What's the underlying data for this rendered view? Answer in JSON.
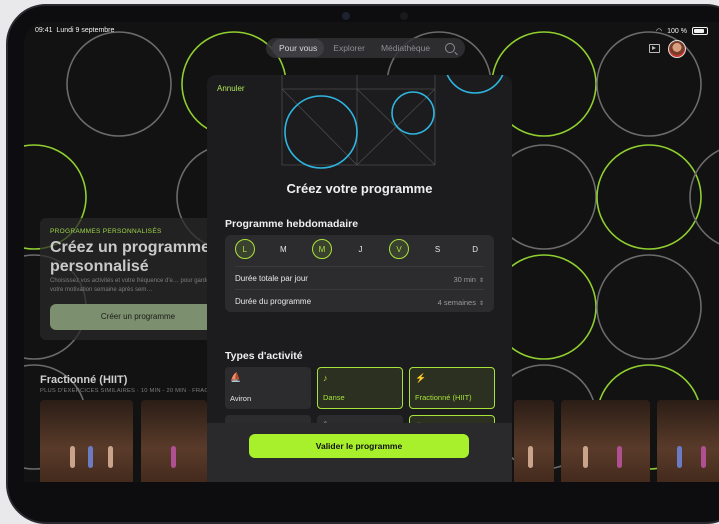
{
  "status_bar": {
    "time": "09:41",
    "date": "Lundi 9 septembre",
    "battery": "100 %"
  },
  "nav": {
    "tabs": [
      "Pour vous",
      "Explorer",
      "Médiathèque"
    ],
    "active_tab": "Pour vous"
  },
  "promo": {
    "kicker": "PROGRAMMES PERSONNALISÉS",
    "title": "Créez un programme personnalisé",
    "description": "Choisissez vos activités et votre fréquence d'e… pour garder votre motivation semaine après sem…",
    "button": "Créer un programme"
  },
  "section": {
    "title": "Fractionné (HIIT)",
    "subtitle": "PLUS D'EXERCICES SIMILAIRES · 10 MIN - 20 MIN · FRACTIONNÉ"
  },
  "modal": {
    "cancel": "Annuler",
    "title": "Créez votre programme",
    "weekly_heading": "Programme hebdomadaire",
    "days": [
      {
        "label": "L",
        "selected": true
      },
      {
        "label": "M",
        "selected": false
      },
      {
        "label": "M",
        "selected": true
      },
      {
        "label": "J",
        "selected": false
      },
      {
        "label": "V",
        "selected": true
      },
      {
        "label": "S",
        "selected": false
      },
      {
        "label": "D",
        "selected": false
      }
    ],
    "daily_duration": {
      "label": "Durée totale par jour",
      "value": "30 min"
    },
    "program_duration": {
      "label": "Durée du programme",
      "value": "4 semaines"
    },
    "activity_heading": "Types d'activité",
    "activities": [
      {
        "label": "Aviron",
        "icon": "rowing-icon",
        "selected": false
      },
      {
        "label": "Danse",
        "icon": "dance-icon",
        "selected": true
      },
      {
        "label": "Fractionné (HIIT)",
        "icon": "hiit-icon",
        "selected": true
      },
      {
        "label": "",
        "icon": "strength-icon",
        "selected": false
      },
      {
        "label": "",
        "icon": "yoga-icon",
        "selected": false
      },
      {
        "label": "",
        "icon": "mindful-cooldown-icon",
        "selected": true
      }
    ],
    "validate": "Valider le programme"
  },
  "colors": {
    "accent": "#a8f02c",
    "background": "#121212",
    "sheet": "#1c1c1e"
  }
}
